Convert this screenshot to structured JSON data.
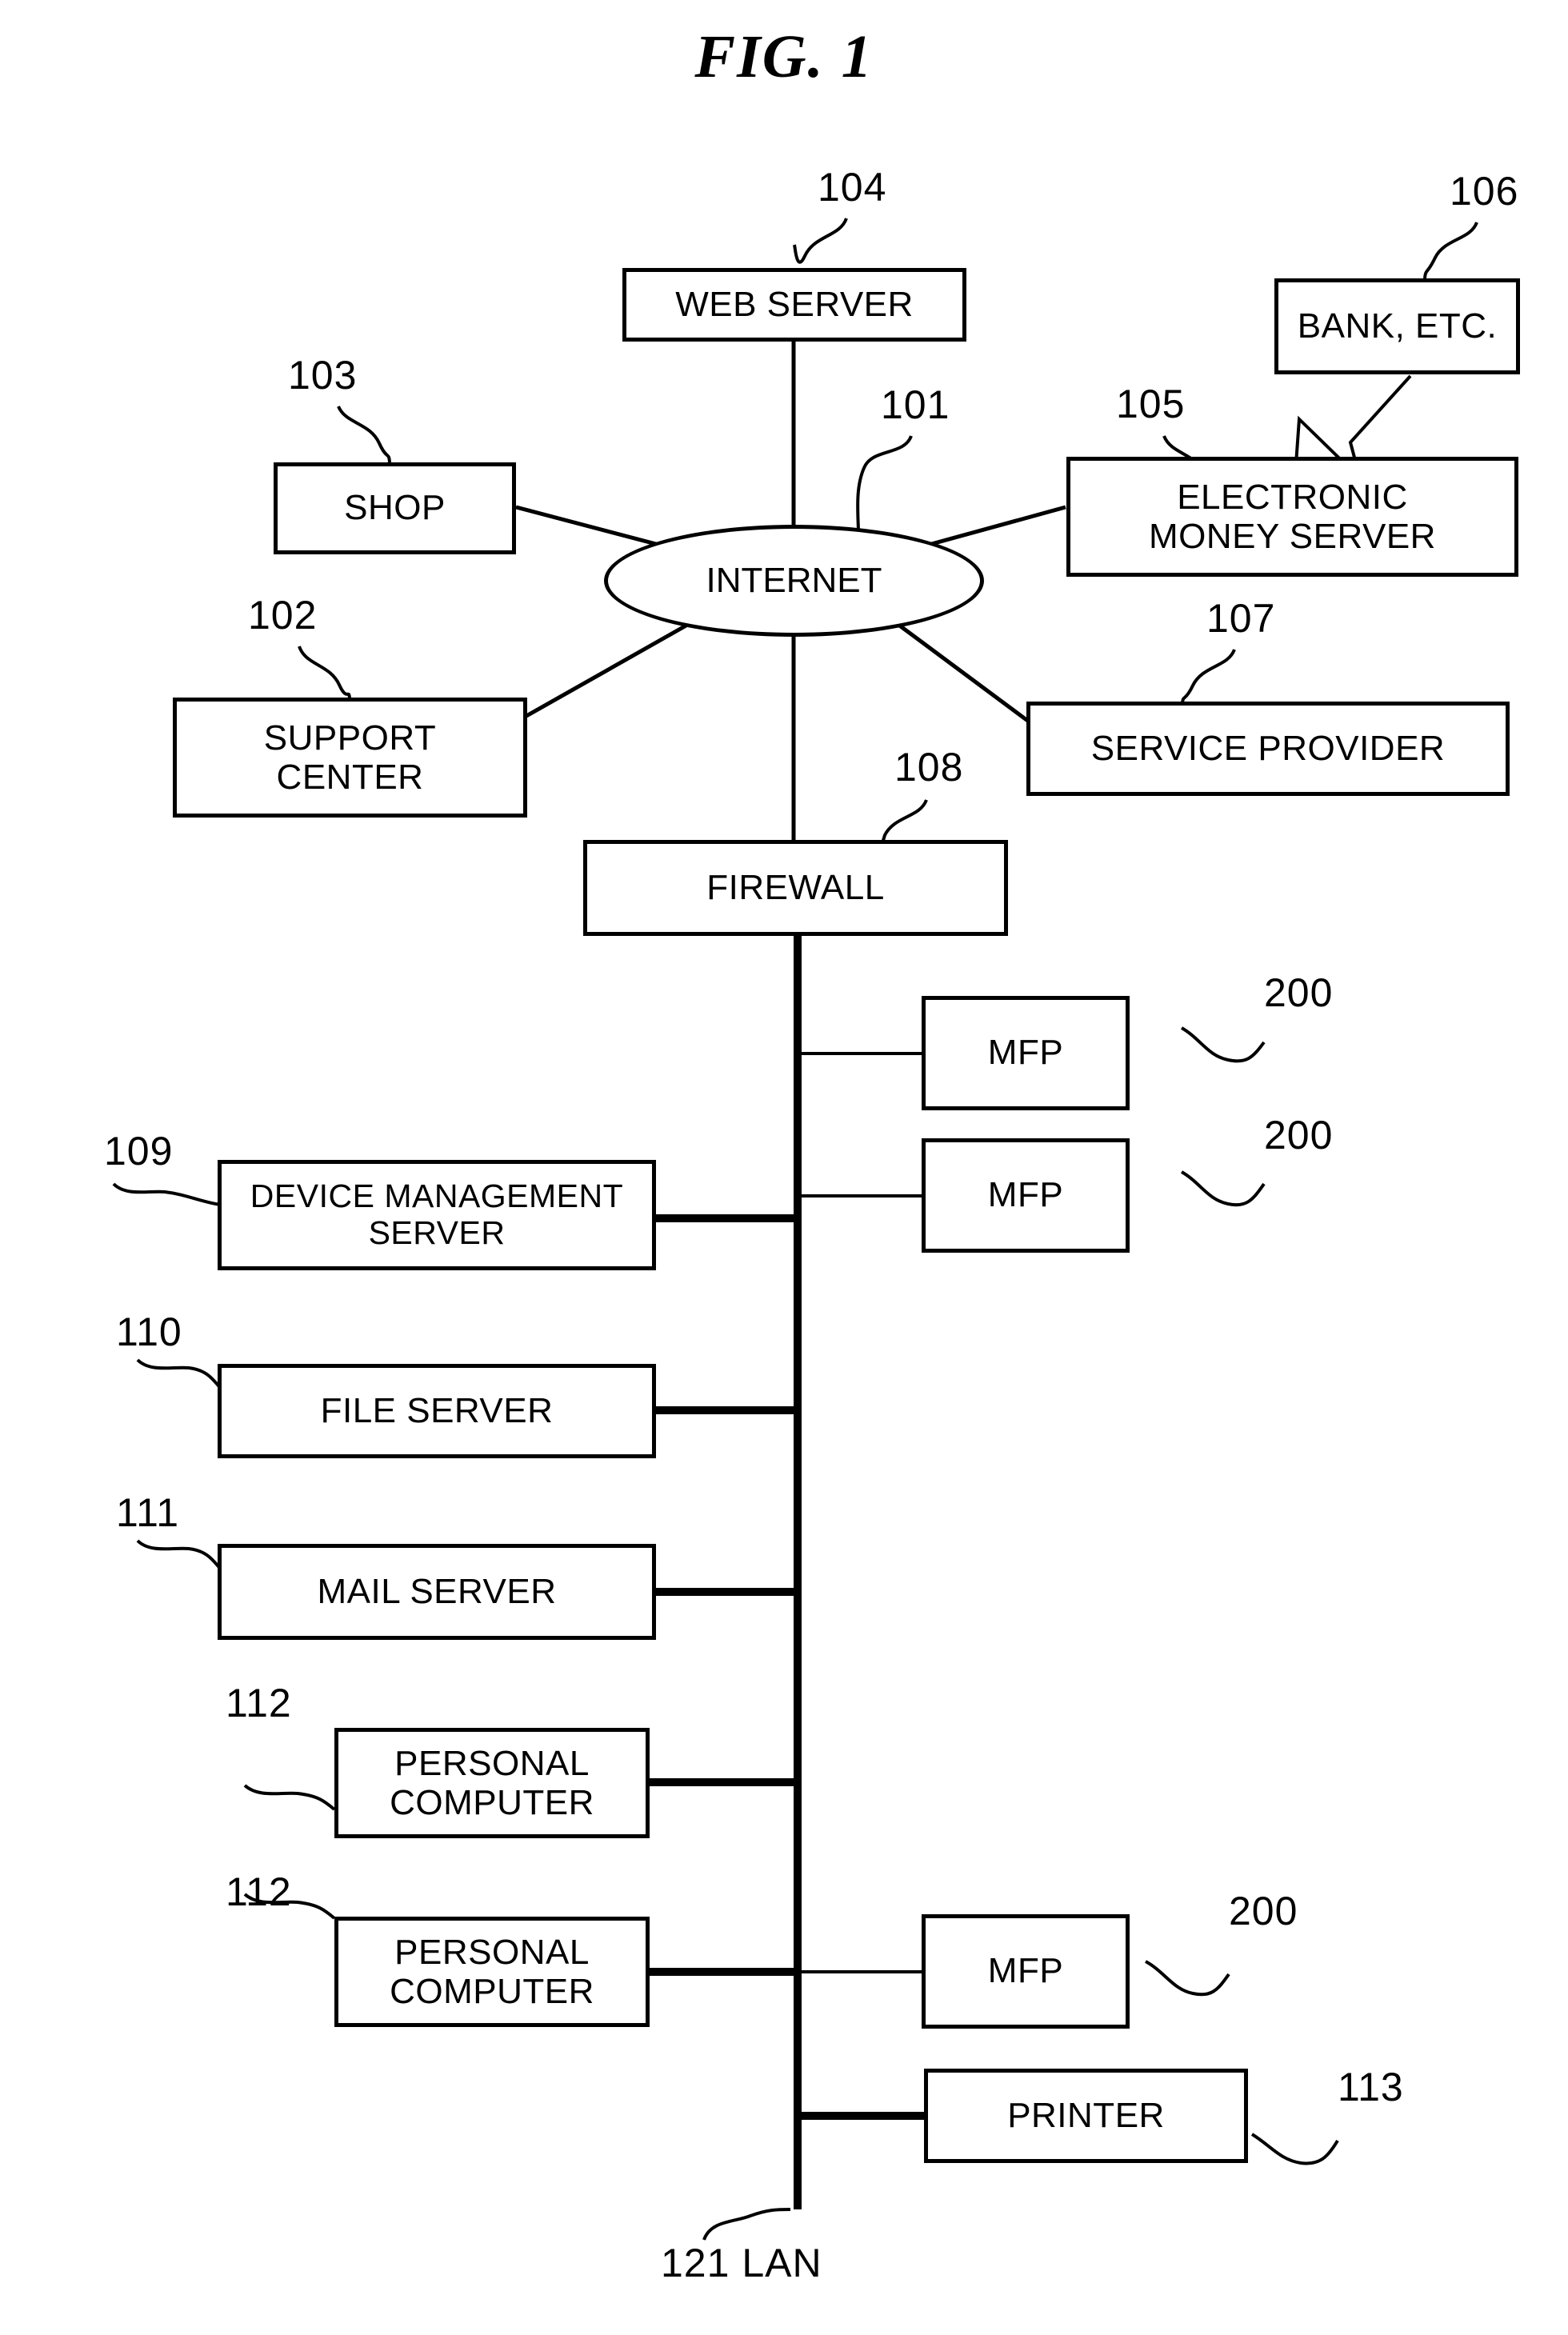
{
  "figure": {
    "title": "FIG. 1"
  },
  "nodes": {
    "internet": {
      "label": "INTERNET",
      "ref": "101"
    },
    "support_center": {
      "line1": "SUPPORT",
      "line2": "CENTER",
      "ref": "102"
    },
    "shop": {
      "label": "SHOP",
      "ref": "103"
    },
    "web_server": {
      "label": "WEB SERVER",
      "ref": "104"
    },
    "electronic_money_server": {
      "line1": "ELECTRONIC",
      "line2": "MONEY SERVER",
      "ref": "105"
    },
    "bank": {
      "label": "BANK, ETC.",
      "ref": "106"
    },
    "service_provider": {
      "label": "SERVICE PROVIDER",
      "ref": "107"
    },
    "firewall": {
      "label": "FIREWALL",
      "ref": "108"
    },
    "mfp_1": {
      "label": "MFP",
      "ref": "200"
    },
    "mfp_2": {
      "label": "MFP",
      "ref": "200"
    },
    "mfp_3": {
      "label": "MFP",
      "ref": "200"
    },
    "device_management_server": {
      "line1": "DEVICE MANAGEMENT",
      "line2": "SERVER",
      "ref": "109"
    },
    "file_server": {
      "label": "FILE SERVER",
      "ref": "110"
    },
    "mail_server": {
      "label": "MAIL SERVER",
      "ref": "111"
    },
    "personal_computer_1": {
      "line1": "PERSONAL",
      "line2": "COMPUTER",
      "ref": "112"
    },
    "personal_computer_2": {
      "line1": "PERSONAL",
      "line2": "COMPUTER",
      "ref": "112"
    },
    "printer": {
      "label": "PRINTER",
      "ref": "113"
    },
    "lan": {
      "label": "121 LAN"
    }
  },
  "colors": {
    "ink": "#000000",
    "background": "#ffffff"
  }
}
